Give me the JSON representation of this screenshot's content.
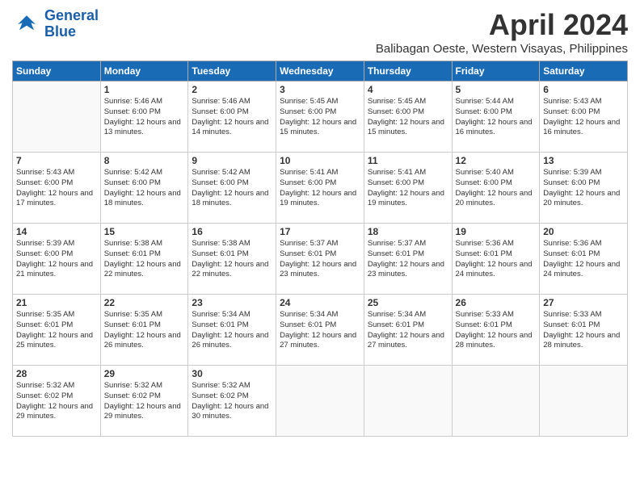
{
  "logo": {
    "line1": "General",
    "line2": "Blue"
  },
  "title": "April 2024",
  "subtitle": "Balibagan Oeste, Western Visayas, Philippines",
  "days_of_week": [
    "Sunday",
    "Monday",
    "Tuesday",
    "Wednesday",
    "Thursday",
    "Friday",
    "Saturday"
  ],
  "weeks": [
    [
      {
        "day": "",
        "info": ""
      },
      {
        "day": "1",
        "info": "Sunrise: 5:46 AM\nSunset: 6:00 PM\nDaylight: 12 hours\nand 13 minutes."
      },
      {
        "day": "2",
        "info": "Sunrise: 5:46 AM\nSunset: 6:00 PM\nDaylight: 12 hours\nand 14 minutes."
      },
      {
        "day": "3",
        "info": "Sunrise: 5:45 AM\nSunset: 6:00 PM\nDaylight: 12 hours\nand 15 minutes."
      },
      {
        "day": "4",
        "info": "Sunrise: 5:45 AM\nSunset: 6:00 PM\nDaylight: 12 hours\nand 15 minutes."
      },
      {
        "day": "5",
        "info": "Sunrise: 5:44 AM\nSunset: 6:00 PM\nDaylight: 12 hours\nand 16 minutes."
      },
      {
        "day": "6",
        "info": "Sunrise: 5:43 AM\nSunset: 6:00 PM\nDaylight: 12 hours\nand 16 minutes."
      }
    ],
    [
      {
        "day": "7",
        "info": "Sunrise: 5:43 AM\nSunset: 6:00 PM\nDaylight: 12 hours\nand 17 minutes."
      },
      {
        "day": "8",
        "info": "Sunrise: 5:42 AM\nSunset: 6:00 PM\nDaylight: 12 hours\nand 18 minutes."
      },
      {
        "day": "9",
        "info": "Sunrise: 5:42 AM\nSunset: 6:00 PM\nDaylight: 12 hours\nand 18 minutes."
      },
      {
        "day": "10",
        "info": "Sunrise: 5:41 AM\nSunset: 6:00 PM\nDaylight: 12 hours\nand 19 minutes."
      },
      {
        "day": "11",
        "info": "Sunrise: 5:41 AM\nSunset: 6:00 PM\nDaylight: 12 hours\nand 19 minutes."
      },
      {
        "day": "12",
        "info": "Sunrise: 5:40 AM\nSunset: 6:00 PM\nDaylight: 12 hours\nand 20 minutes."
      },
      {
        "day": "13",
        "info": "Sunrise: 5:39 AM\nSunset: 6:00 PM\nDaylight: 12 hours\nand 20 minutes."
      }
    ],
    [
      {
        "day": "14",
        "info": "Sunrise: 5:39 AM\nSunset: 6:00 PM\nDaylight: 12 hours\nand 21 minutes."
      },
      {
        "day": "15",
        "info": "Sunrise: 5:38 AM\nSunset: 6:01 PM\nDaylight: 12 hours\nand 22 minutes."
      },
      {
        "day": "16",
        "info": "Sunrise: 5:38 AM\nSunset: 6:01 PM\nDaylight: 12 hours\nand 22 minutes."
      },
      {
        "day": "17",
        "info": "Sunrise: 5:37 AM\nSunset: 6:01 PM\nDaylight: 12 hours\nand 23 minutes."
      },
      {
        "day": "18",
        "info": "Sunrise: 5:37 AM\nSunset: 6:01 PM\nDaylight: 12 hours\nand 23 minutes."
      },
      {
        "day": "19",
        "info": "Sunrise: 5:36 AM\nSunset: 6:01 PM\nDaylight: 12 hours\nand 24 minutes."
      },
      {
        "day": "20",
        "info": "Sunrise: 5:36 AM\nSunset: 6:01 PM\nDaylight: 12 hours\nand 24 minutes."
      }
    ],
    [
      {
        "day": "21",
        "info": "Sunrise: 5:35 AM\nSunset: 6:01 PM\nDaylight: 12 hours\nand 25 minutes."
      },
      {
        "day": "22",
        "info": "Sunrise: 5:35 AM\nSunset: 6:01 PM\nDaylight: 12 hours\nand 26 minutes."
      },
      {
        "day": "23",
        "info": "Sunrise: 5:34 AM\nSunset: 6:01 PM\nDaylight: 12 hours\nand 26 minutes."
      },
      {
        "day": "24",
        "info": "Sunrise: 5:34 AM\nSunset: 6:01 PM\nDaylight: 12 hours\nand 27 minutes."
      },
      {
        "day": "25",
        "info": "Sunrise: 5:34 AM\nSunset: 6:01 PM\nDaylight: 12 hours\nand 27 minutes."
      },
      {
        "day": "26",
        "info": "Sunrise: 5:33 AM\nSunset: 6:01 PM\nDaylight: 12 hours\nand 28 minutes."
      },
      {
        "day": "27",
        "info": "Sunrise: 5:33 AM\nSunset: 6:01 PM\nDaylight: 12 hours\nand 28 minutes."
      }
    ],
    [
      {
        "day": "28",
        "info": "Sunrise: 5:32 AM\nSunset: 6:02 PM\nDaylight: 12 hours\nand 29 minutes."
      },
      {
        "day": "29",
        "info": "Sunrise: 5:32 AM\nSunset: 6:02 PM\nDaylight: 12 hours\nand 29 minutes."
      },
      {
        "day": "30",
        "info": "Sunrise: 5:32 AM\nSunset: 6:02 PM\nDaylight: 12 hours\nand 30 minutes."
      },
      {
        "day": "",
        "info": ""
      },
      {
        "day": "",
        "info": ""
      },
      {
        "day": "",
        "info": ""
      },
      {
        "day": "",
        "info": ""
      }
    ]
  ]
}
